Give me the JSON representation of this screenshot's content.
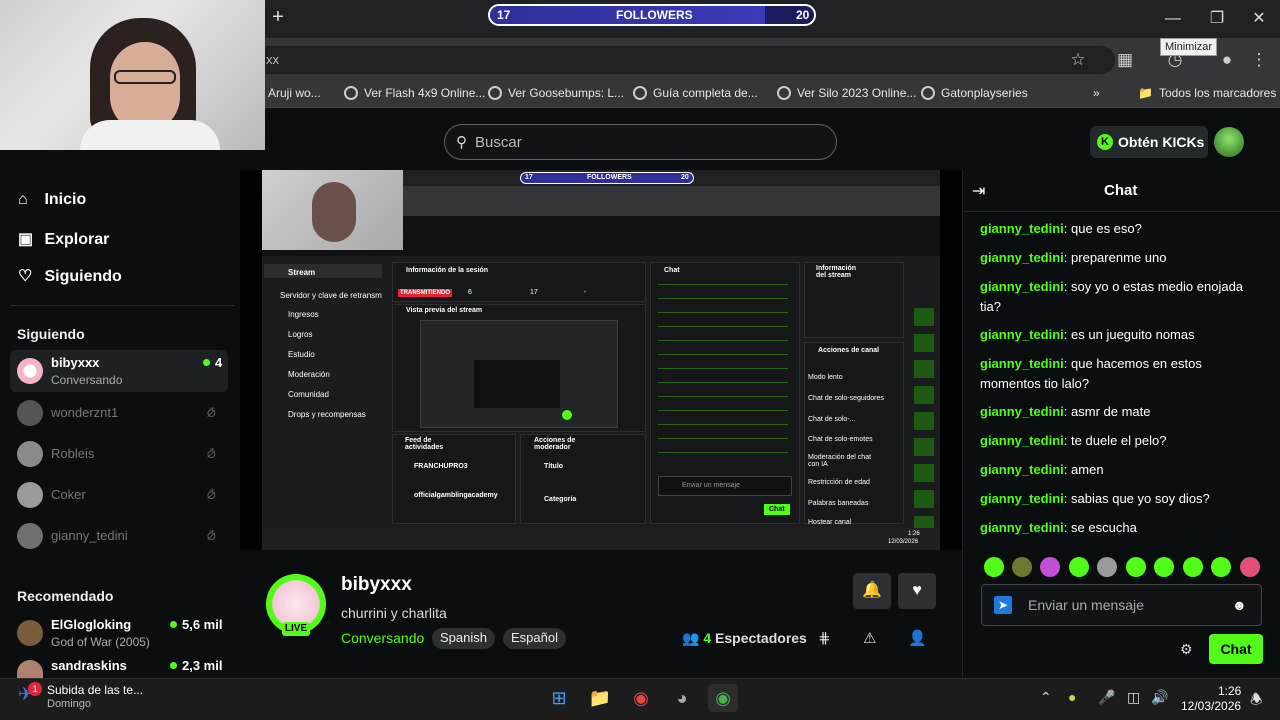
{
  "overlay": {
    "followers_label": "FOLLOWERS",
    "followers_current": "17",
    "followers_goal": "20",
    "followers_progress": 0.85
  },
  "browser": {
    "new_tab": "+",
    "address": "xx",
    "tooltip": "Minimizar",
    "bookmarks": [
      "Aruji wo...",
      "Ver Flash 4x9 Online...",
      "Ver Goosebumps: L...",
      "Guía completa de...",
      "Ver Silo 2023 Online...",
      "Gatonplayseries"
    ],
    "bookmarks_more": "»",
    "all_bookmarks": "Todos los marcadores"
  },
  "header": {
    "search_placeholder": "Buscar",
    "kicks_label": "Obtén KICKs"
  },
  "sidebar": {
    "nav": [
      {
        "label": "Inicio",
        "icon": "home-icon"
      },
      {
        "label": "Explorar",
        "icon": "explore-icon"
      },
      {
        "label": "Siguiendo",
        "icon": "heart-icon"
      }
    ],
    "following_title": "Siguiendo",
    "following": [
      {
        "name": "bibyxxx",
        "sub": "Conversando",
        "viewers": "4"
      },
      {
        "name": "wonderznt1"
      },
      {
        "name": "Robleis"
      },
      {
        "name": "Coker"
      },
      {
        "name": "gianny_tedini"
      }
    ],
    "recommended_title": "Recomendado",
    "recommended": [
      {
        "name": "ElGlogloking",
        "sub": "God of War (2005)",
        "viewers": "5,6 mil"
      },
      {
        "name": "sandraskins",
        "viewers": "2,3 mil"
      }
    ]
  },
  "stream": {
    "name": "bibyxxx",
    "title": "churrini y charlita",
    "live": "LIVE",
    "category": "Conversando",
    "tags": [
      "Spanish",
      "Español"
    ],
    "viewers_count": "4",
    "viewers_label": "Espectadores"
  },
  "preview": {
    "followers_current": "17",
    "followers_label": "FOLLOWERS",
    "followers_goal": "20",
    "stream_label": "Stream",
    "menu": [
      "Servidor y clave de retransm",
      "Ingresos",
      "Logros",
      "Estudio",
      "Moderación",
      "Comunidad",
      "Drops y recompensas"
    ],
    "session_title": "Información de la sesión",
    "transmitting": "TRANSMITIENDO",
    "session_values": [
      "6",
      "17",
      "-"
    ],
    "preview_title": "Vista previa del stream",
    "feed_title": "Feed de actividades",
    "feed_items": [
      "FRANCHUPRO3",
      "officialgamblingacademy"
    ],
    "mod_title": "Acciones de moderador",
    "mod_items": [
      "Título",
      "Categoría"
    ],
    "chat_title": "Chat",
    "chat_placeholder": "Enviar un mensaje",
    "chat_send": "Chat",
    "info_title": "Información del stream",
    "channel_actions": "Acciones de canal",
    "channel_items": [
      "Modo lento",
      "Chat de solo-seguidores",
      "Chat de solo-...",
      "Chat de solo-emotes",
      "Moderación del chat con IA",
      "Restricción de edad",
      "Palabras baneadas",
      "Hostear canal"
    ],
    "taskbar_time": "1:26",
    "taskbar_date": "12/03/2026"
  },
  "chat": {
    "title": "Chat",
    "messages": [
      {
        "user": "gianny_tedini",
        "text": "que es eso?"
      },
      {
        "user": "gianny_tedini",
        "text": "preparenme uno"
      },
      {
        "user": "gianny_tedini",
        "text": "soy yo o estas medio enojada tia?"
      },
      {
        "user": "gianny_tedini",
        "text": "es un jueguito nomas"
      },
      {
        "user": "gianny_tedini",
        "text": "que hacemos en estos momentos tio lalo?"
      },
      {
        "user": "gianny_tedini",
        "text": "asmr de mate"
      },
      {
        "user": "gianny_tedini",
        "text": "te duele el pelo?"
      },
      {
        "user": "gianny_tedini",
        "text": "amen"
      },
      {
        "user": "gianny_tedini",
        "text": "sabias que yo soy dios?"
      },
      {
        "user": "gianny_tedini",
        "text": "se escucha"
      }
    ],
    "input_placeholder": "Enviar un mensaje",
    "send_label": "Chat"
  },
  "taskbar": {
    "notification_title": "Subida de las te...",
    "notification_sub": "Domingo",
    "time": "1:26",
    "date": "12/03/2026"
  },
  "colors": {
    "accent": "#53fc18",
    "background": "#0b0e0f",
    "chrome": "#35363a"
  }
}
